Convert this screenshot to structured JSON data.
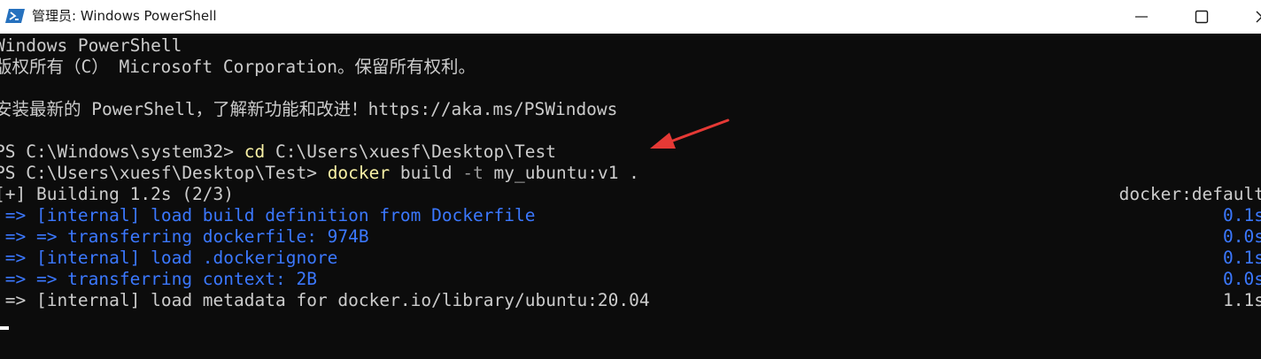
{
  "window": {
    "title": "管理员: Windows PowerShell"
  },
  "icons": {
    "app": "powershell-icon",
    "minimize": "minimize-icon",
    "maximize": "maximize-icon",
    "close": "close-icon",
    "annotation": "red-arrow-annotation"
  },
  "colors": {
    "background": "#0c0c0c",
    "text": "#cccccc",
    "command": "#f9f1a5",
    "progress": "#3b78ff",
    "annotation": "#e53935"
  },
  "console": {
    "header": {
      "line1": "Windows PowerShell",
      "line2": "版权所有（C） Microsoft Corporation。保留所有权利。",
      "line3": "安装最新的 PowerShell，了解新功能和改进！https://aka.ms/PSWindows"
    },
    "commands": [
      {
        "prompt": "PS C:\\Windows\\system32> ",
        "command": "cd",
        "args": " C:\\Users\\xuesf\\Desktop\\Test"
      },
      {
        "prompt": "PS C:\\Users\\xuesf\\Desktop\\Test> ",
        "command": "docker",
        "args": " build ",
        "flag": "-t",
        "rest": " my_ubuntu:v1 ."
      }
    ],
    "build": {
      "status": "[+] Building 1.2s (2/3)",
      "context": "docker:default",
      "steps": [
        {
          "text": " => [internal] load build definition from Dockerfile",
          "time": "0.1s"
        },
        {
          "text": " => => transferring dockerfile: 974B",
          "time": "0.0s"
        },
        {
          "text": " => [internal] load .dockerignore",
          "time": "0.1s"
        },
        {
          "text": " => => transferring context: 2B",
          "time": "0.0s"
        },
        {
          "text": " => [internal] load metadata for docker.io/library/ubuntu:20.04",
          "time": "1.1s"
        }
      ]
    }
  }
}
